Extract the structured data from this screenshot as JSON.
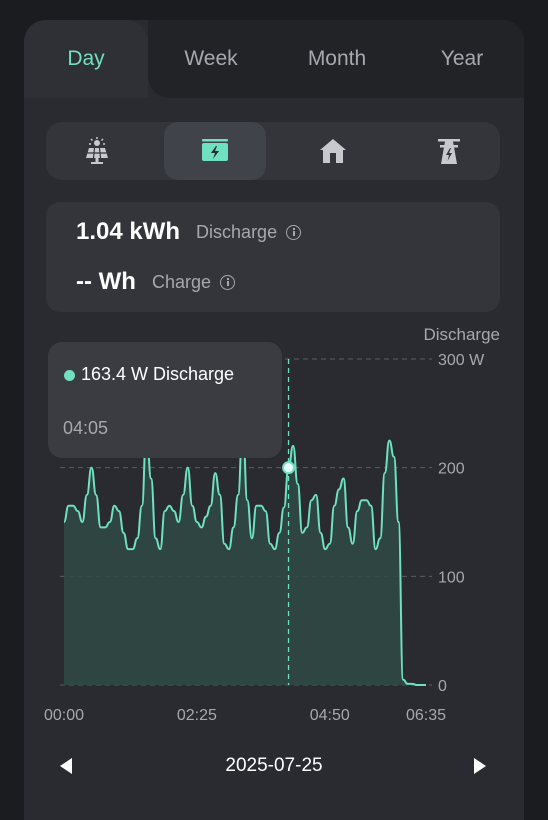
{
  "tabs": [
    {
      "label": "Day",
      "active": true
    },
    {
      "label": "Week",
      "active": false
    },
    {
      "label": "Month",
      "active": false
    },
    {
      "label": "Year",
      "active": false
    }
  ],
  "icons": [
    {
      "name": "solar-panel-icon",
      "active": false
    },
    {
      "name": "battery-icon",
      "active": true
    },
    {
      "name": "home-icon",
      "active": false
    },
    {
      "name": "grid-tower-icon",
      "active": false
    }
  ],
  "summary": {
    "discharge_value": "1.04 kWh",
    "discharge_label": "Discharge",
    "charge_value": "-- Wh",
    "charge_label": "Charge"
  },
  "tooltip": {
    "value_text": "163.4 W Discharge",
    "time": "04:05"
  },
  "date_nav": {
    "date": "2025-07-25"
  },
  "colors": {
    "accent": "#6fe0c0",
    "background": "#1b1c20",
    "card": "#2a2b31"
  },
  "chart_data": {
    "type": "area",
    "title": "Discharge",
    "y_unit": "W",
    "ylim": [
      0,
      300
    ],
    "y_ticks": [
      "300 W",
      "200",
      "100",
      "0"
    ],
    "x_tick_labels": [
      "00:00",
      "02:25",
      "04:50",
      "06:35"
    ],
    "grid": true,
    "series": [
      {
        "name": "Discharge",
        "x": [
          "00:00",
          "00:05",
          "00:10",
          "00:15",
          "00:20",
          "00:25",
          "00:30",
          "00:35",
          "00:40",
          "00:45",
          "00:50",
          "00:55",
          "01:00",
          "01:05",
          "01:10",
          "01:15",
          "01:20",
          "01:25",
          "01:30",
          "01:35",
          "01:40",
          "01:45",
          "01:50",
          "01:55",
          "02:00",
          "02:05",
          "02:10",
          "02:15",
          "02:20",
          "02:25",
          "02:30",
          "02:35",
          "02:40",
          "02:45",
          "02:50",
          "02:55",
          "03:00",
          "03:05",
          "03:10",
          "03:15",
          "03:20",
          "03:25",
          "03:30",
          "03:35",
          "03:40",
          "03:45",
          "03:50",
          "03:55",
          "04:00",
          "04:05",
          "04:10",
          "04:15",
          "04:20",
          "04:25",
          "04:30",
          "04:35",
          "04:40",
          "04:45",
          "04:50",
          "04:55",
          "05:00",
          "05:05",
          "05:10",
          "05:15",
          "05:20",
          "05:25",
          "05:30",
          "05:35",
          "05:40",
          "05:45",
          "05:50",
          "05:55",
          "06:00",
          "06:05",
          "06:10",
          "06:15",
          "06:20",
          "06:25",
          "06:30",
          "06:35"
        ],
        "values": [
          150,
          165,
          165,
          160,
          150,
          175,
          200,
          175,
          145,
          145,
          150,
          165,
          160,
          140,
          125,
          125,
          135,
          165,
          235,
          190,
          135,
          125,
          160,
          165,
          160,
          150,
          175,
          200,
          165,
          150,
          145,
          155,
          165,
          195,
          175,
          130,
          125,
          145,
          175,
          240,
          170,
          135,
          165,
          165,
          160,
          130,
          125,
          140,
          163.4,
          200,
          220,
          185,
          140,
          145,
          170,
          175,
          140,
          125,
          130,
          165,
          180,
          190,
          145,
          130,
          160,
          170,
          170,
          165,
          125,
          135,
          195,
          225,
          210,
          150,
          5,
          1,
          1,
          0,
          0,
          0
        ]
      }
    ]
  }
}
